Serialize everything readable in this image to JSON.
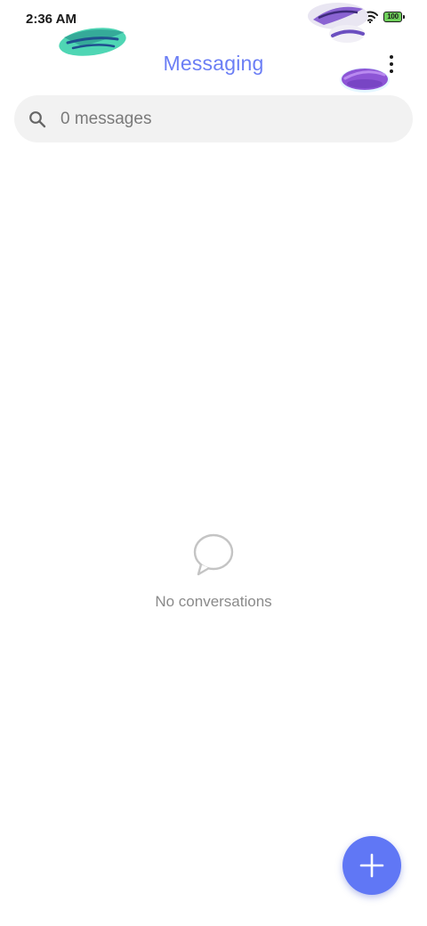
{
  "status_bar": {
    "time": "2:36 AM",
    "battery_level": "100",
    "icons": [
      "signal-icon",
      "wifi-icon",
      "battery-icon"
    ]
  },
  "header": {
    "title": "Messaging",
    "title_color": "#6b7ef5",
    "menu_icon": "more-vert-icon"
  },
  "search": {
    "icon": "search-icon",
    "placeholder": "0 messages"
  },
  "empty_state": {
    "icon": "chat-bubble-icon",
    "text": "No conversations"
  },
  "fab": {
    "icon": "plus-icon",
    "color": "#6077f5"
  },
  "colors": {
    "accent": "#6b7ef5",
    "search_background": "#f2f2f2",
    "muted_text": "#8a8a8a"
  }
}
